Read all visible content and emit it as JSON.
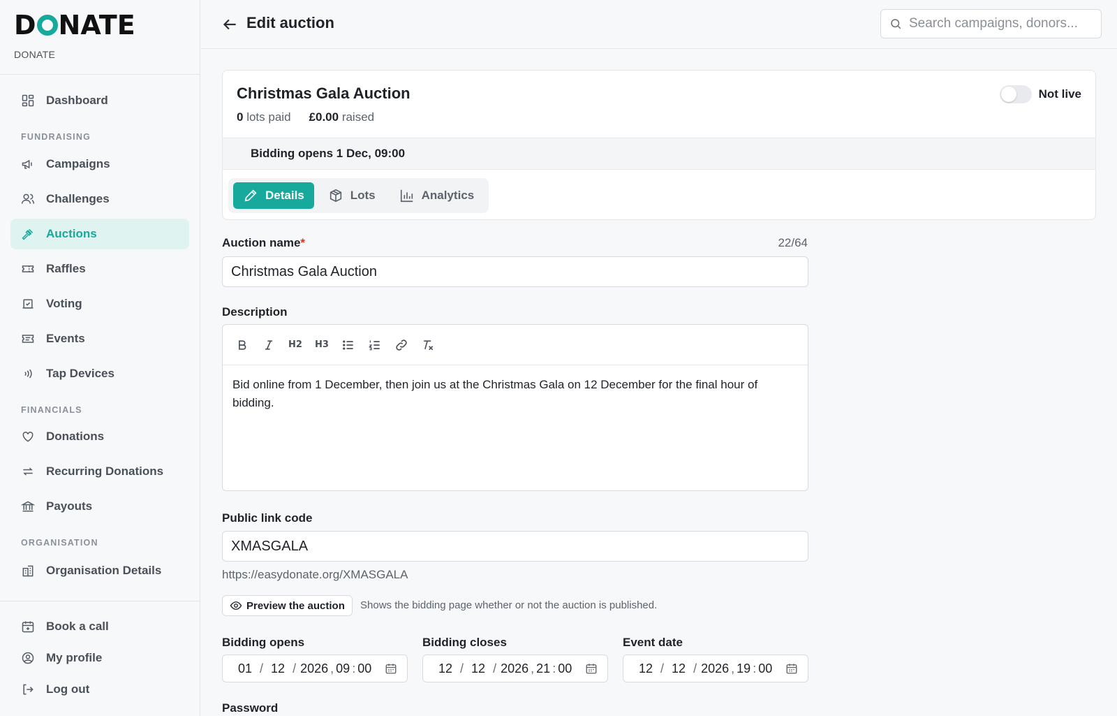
{
  "brand": {
    "logo_pre": "D",
    "logo_post": "NATE",
    "subtitle": "DONATE"
  },
  "sidebar": {
    "dashboard": "Dashboard",
    "fundraising_label": "FUNDRAISING",
    "campaigns": "Campaigns",
    "challenges": "Challenges",
    "auctions": "Auctions",
    "raffles": "Raffles",
    "voting": "Voting",
    "events": "Events",
    "tap_devices": "Tap Devices",
    "financials_label": "FINANCIALS",
    "donations": "Donations",
    "recurring_donations": "Recurring Donations",
    "payouts": "Payouts",
    "organisation_label": "ORGANISATION",
    "organisation_details": "Organisation Details",
    "book_call": "Book a call",
    "my_profile": "My profile",
    "log_out": "Log out"
  },
  "header": {
    "title": "Edit auction",
    "search_placeholder": "Search campaigns, donors..."
  },
  "auction": {
    "name": "Christmas Gala Auction",
    "lots_paid_count": "0",
    "lots_paid_label": "lots paid",
    "raised_amount": "£0.00",
    "raised_label": "raised",
    "status_label": "Not live",
    "live": false,
    "bidding_opens_banner": "Bidding opens 1 Dec, 09:00"
  },
  "tabs": {
    "details": "Details",
    "lots": "Lots",
    "analytics": "Analytics"
  },
  "form": {
    "name_label": "Auction name",
    "name_required": "*",
    "name_counter": "22/64",
    "name_value": "Christmas Gala Auction",
    "description_label": "Description",
    "toolbar": {
      "h2": "H2",
      "h3": "H3"
    },
    "description_value": "Bid online from 1 December, then join us at the Christmas Gala on 12 December for the final hour of bidding.",
    "link_code_label": "Public link code",
    "link_code_value": "XMASGALA",
    "link_url": "https://easydonate.org/XMASGALA",
    "preview_button": "Preview the auction",
    "preview_help": "Shows the bidding page whether or not the auction is published.",
    "bidding_opens_label": "Bidding opens",
    "bidding_opens": {
      "day": "01",
      "month": "12",
      "year": "2026",
      "hour": "09",
      "minute": "00"
    },
    "bidding_closes_label": "Bidding closes",
    "bidding_closes": {
      "day": "12",
      "month": "12",
      "year": "2026",
      "hour": "21",
      "minute": "00"
    },
    "event_date_label": "Event date",
    "event_date": {
      "day": "12",
      "month": "12",
      "year": "2026",
      "hour": "19",
      "minute": "00"
    },
    "password_label": "Password"
  },
  "colors": {
    "accent": "#17a99c",
    "accent_bg": "#dff3f0",
    "required": "#d9342b"
  }
}
